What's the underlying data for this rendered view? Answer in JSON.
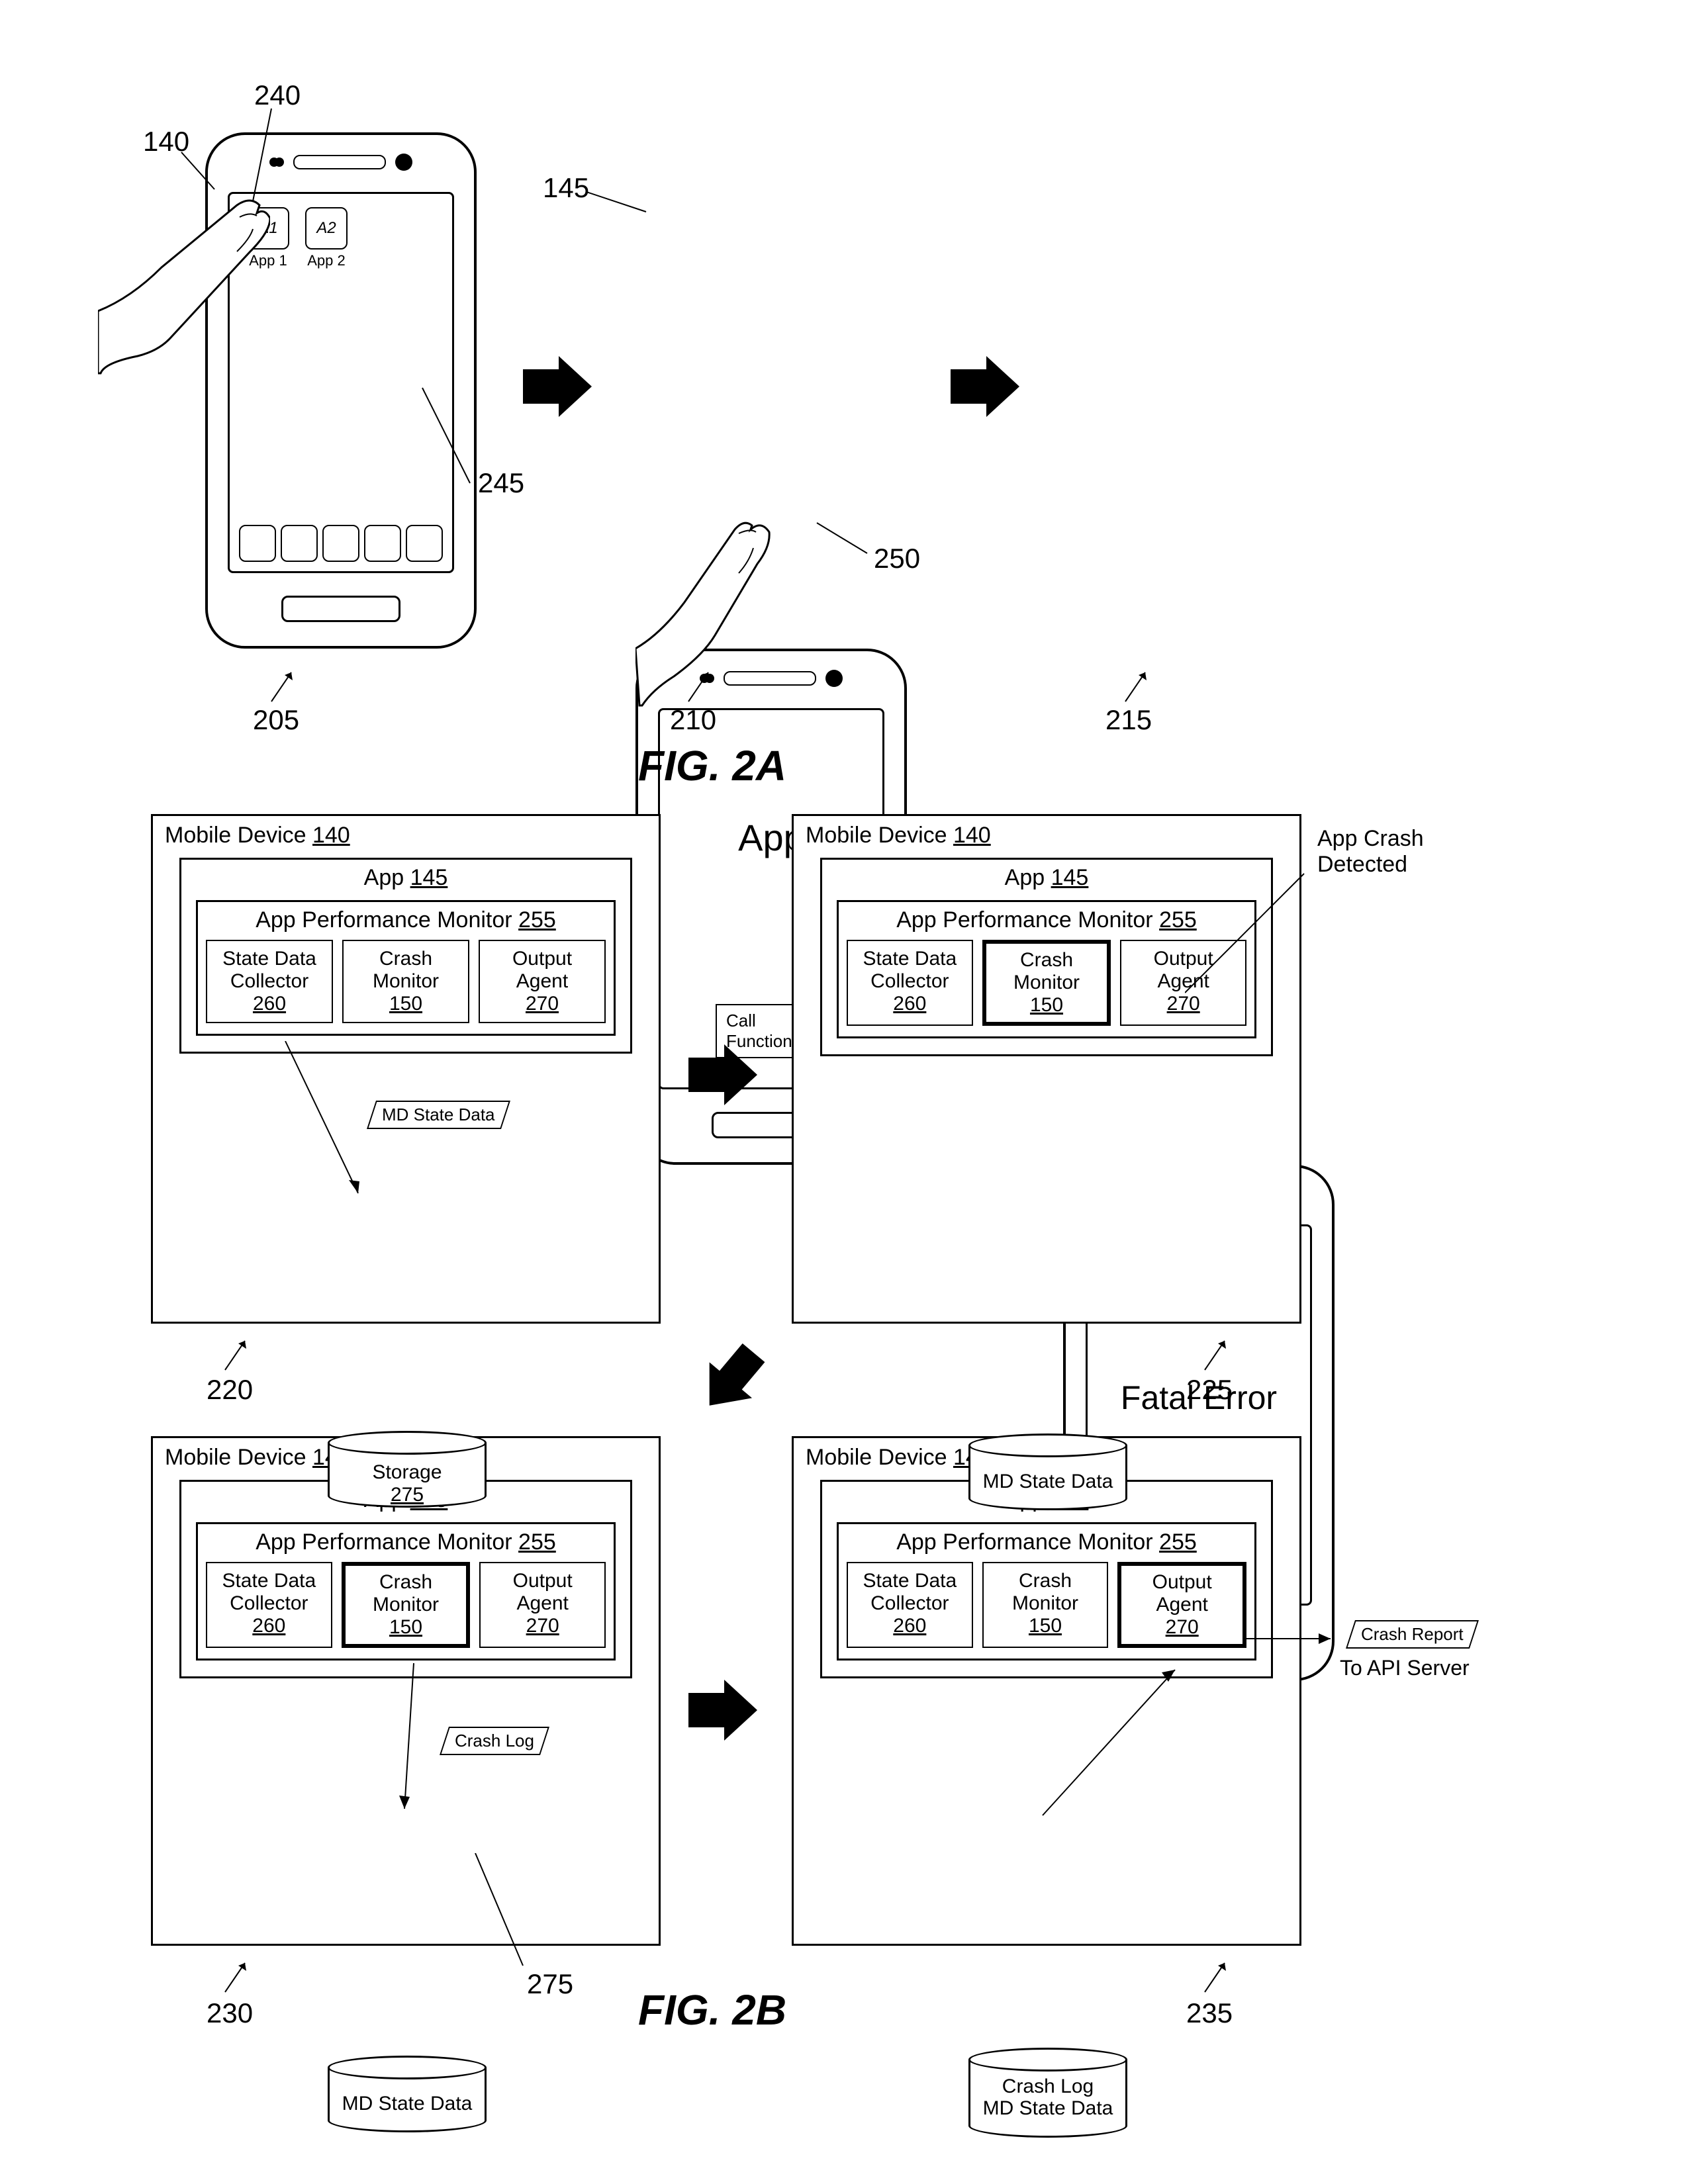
{
  "fig2a": {
    "title": "FIG. 2A",
    "refs": {
      "r140": "140",
      "r240": "240",
      "r245": "245",
      "r205": "205",
      "r145": "145",
      "r210": "210",
      "r250": "250",
      "r215": "215"
    },
    "phone1": {
      "icon1_text": "A1",
      "icon1_label": "App 1",
      "icon2_text": "A2",
      "icon2_label": "App 2"
    },
    "phone2": {
      "app_text": "App",
      "button_text": "Call Function"
    },
    "phone3": {
      "text": "Fatal Error"
    }
  },
  "fig2b": {
    "title": "FIG. 2B",
    "refs": {
      "r220": "220",
      "r225": "225",
      "r230": "230",
      "r235": "235",
      "r275_inline": "275"
    },
    "common": {
      "md_prefix": "Mobile Device ",
      "md_num": "140",
      "app_prefix": "App ",
      "app_num": "145",
      "apm_prefix": "App Performance Monitor ",
      "apm_num": "255",
      "sdc_l1": "State Data",
      "sdc_l2": "Collector",
      "sdc_num": "260",
      "cm_l1": "Crash",
      "cm_l2": "Monitor",
      "cm_num": "150",
      "oa_l1": "Output",
      "oa_l2": "Agent",
      "oa_num": "270"
    },
    "block220": {
      "para_label": "MD State Data",
      "storage_l1": "Storage",
      "storage_num": "275"
    },
    "block225": {
      "note": "App Crash Detected",
      "storage_l1": "MD State Data"
    },
    "block230": {
      "para_label": "Crash Log",
      "storage_l1": "MD State Data"
    },
    "block235": {
      "storage_l1": "Crash Log",
      "storage_l2": "MD State Data",
      "report_label": "Crash Report",
      "report_dest": "To API Server"
    }
  }
}
